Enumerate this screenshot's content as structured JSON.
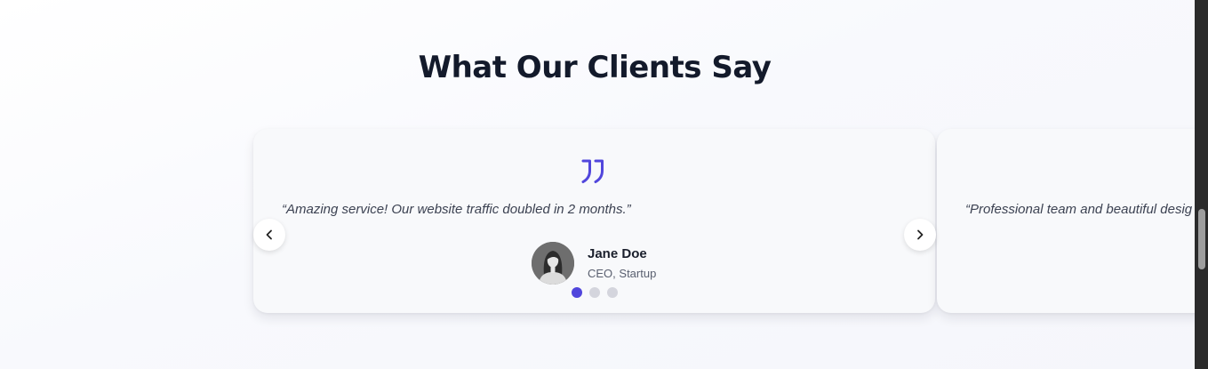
{
  "section": {
    "title": "What Our Clients Say"
  },
  "testimonials": [
    {
      "quote": "“Amazing service! Our website traffic doubled in 2 months.”",
      "author_name": "Jane Doe",
      "author_role": "CEO, Startup",
      "quote_icon": "quote-icon",
      "avatar": "avatar"
    },
    {
      "quote": "“Professional team and beautiful desig"
    }
  ],
  "carousel": {
    "prev_icon": "chevron-left-icon",
    "next_icon": "chevron-right-icon",
    "dot_count": 3,
    "active_dot": 1
  },
  "colors": {
    "accent": "#5146dc",
    "title": "#131a2b",
    "card_bg": "#f8f9fb",
    "dot_inactive": "#d4d5dd"
  }
}
